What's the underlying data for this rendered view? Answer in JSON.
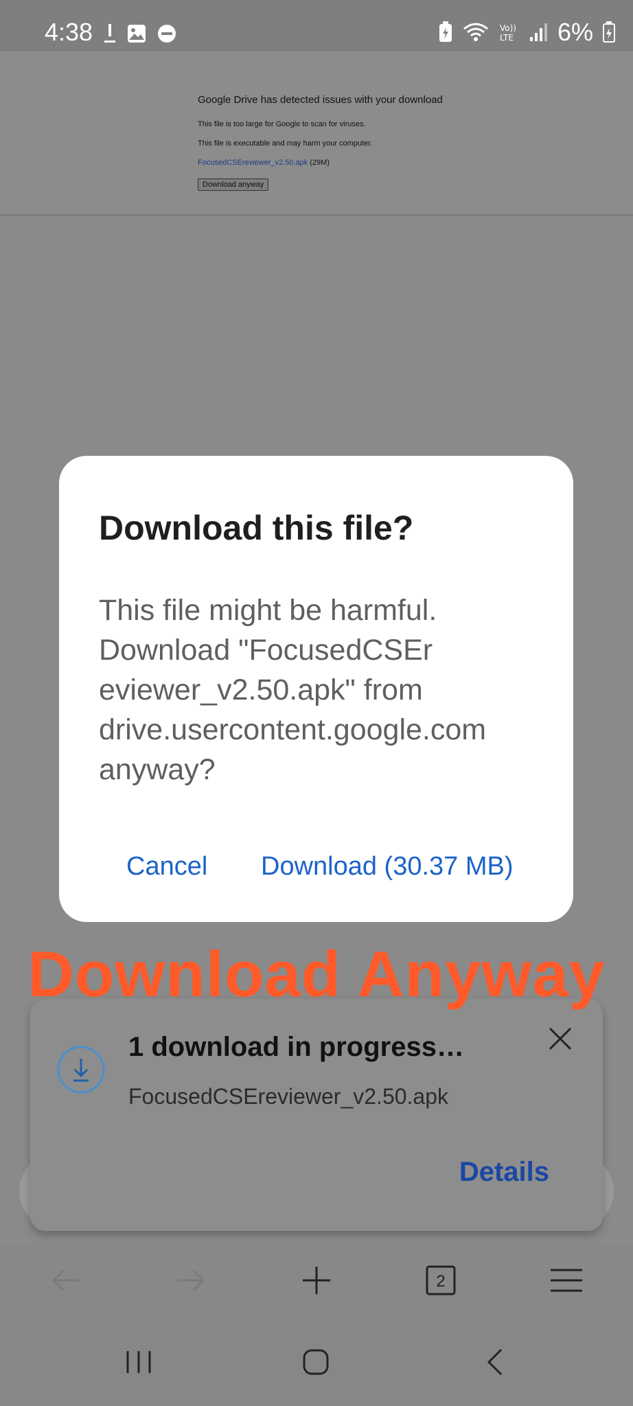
{
  "status_bar": {
    "time": "4:38",
    "battery_percent": "6%",
    "icons": [
      "download-notification-icon",
      "gallery-icon",
      "dnd-icon",
      "battery-saver-icon",
      "wifi-icon",
      "volte-icon",
      "signal-icon",
      "battery-icon"
    ]
  },
  "webpage": {
    "heading": "Google Drive has detected issues with your download",
    "line1": "This file is too large for Google to scan for viruses.",
    "line2": "This file is executable and may harm your computer.",
    "file_link": "FocusedCSEreviewer_v2.50.apk",
    "file_size": "(29M)",
    "download_anyway_button": "Download anyway"
  },
  "dialog": {
    "title": "Download this file?",
    "body": "This file might be harmful.\nDownload \"FocusedCSEr\neviewer_v2.50.apk\" from\ndrive.usercontent.google.com\nanyway?",
    "cancel_label": "Cancel",
    "download_label": "Download (30.37 MB)",
    "accent_color": "#1a63c9"
  },
  "overlay_annotation": {
    "text": "Download Anyway",
    "color": "#ff5a2a"
  },
  "download_card": {
    "title": "1 download in progress…",
    "filename": "FocusedCSEreviewer_v2.50.apk",
    "details_label": "Details"
  },
  "browser_toolbar": {
    "tab_count": "2",
    "icons": [
      "back-icon",
      "forward-icon",
      "new-tab-icon",
      "tabs-icon",
      "menu-icon"
    ]
  },
  "nav_bar": {
    "icons": [
      "recent-apps-icon",
      "home-icon",
      "back-nav-icon"
    ]
  }
}
